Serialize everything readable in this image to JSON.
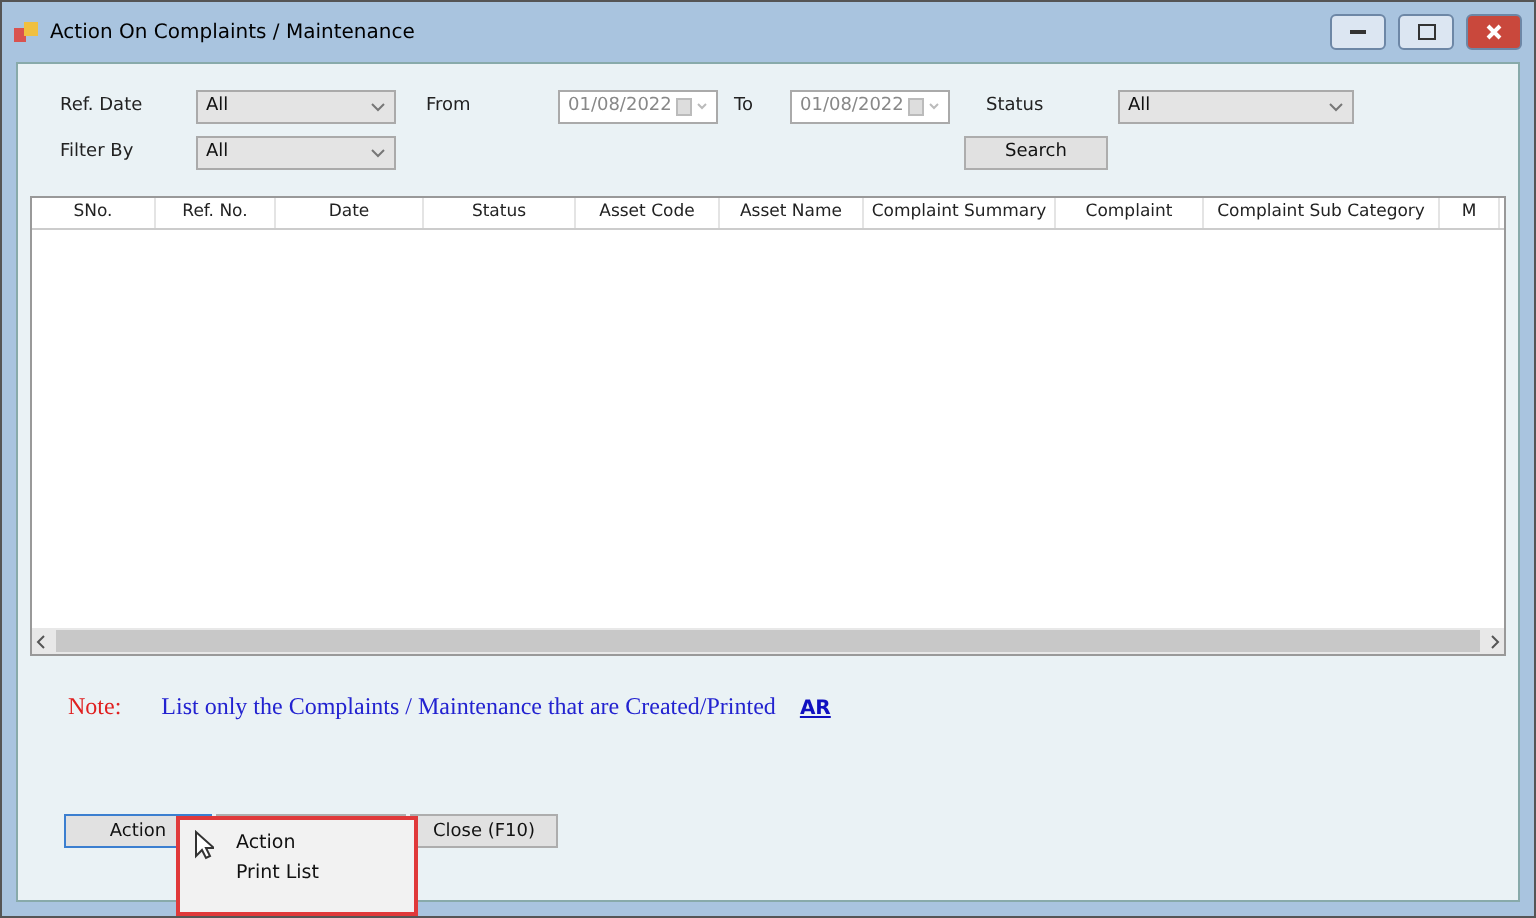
{
  "window": {
    "title": "Action On Complaints / Maintenance"
  },
  "filters": {
    "ref_date_label": "Ref. Date",
    "ref_date_value": "All",
    "from_label": "From",
    "from_value": "01/08/2022",
    "to_label": "To",
    "to_value": "01/08/2022",
    "status_label": "Status",
    "status_value": "All",
    "filter_by_label": "Filter By",
    "filter_by_value": "All",
    "search_button": "Search"
  },
  "table": {
    "columns": [
      {
        "label": "SNo."
      },
      {
        "label": "Ref. No."
      },
      {
        "label": "Date"
      },
      {
        "label": "Status"
      },
      {
        "label": "Asset Code"
      },
      {
        "label": "Asset Name"
      },
      {
        "label": "Complaint Summary"
      },
      {
        "label": "Complaint"
      },
      {
        "label": "Complaint Sub Category"
      },
      {
        "label": "M"
      }
    ]
  },
  "note": {
    "label": "Note:",
    "text": "List only the Complaints / Maintenance that are Created/Printed",
    "link": "AR"
  },
  "buttons": [
    {
      "label": "Action",
      "kind": "focused"
    },
    {
      "kind": "covered"
    },
    {
      "label": "Close (F10)",
      "kind": "normal"
    }
  ],
  "menu": {
    "items": [
      "Action",
      "Print List"
    ]
  }
}
